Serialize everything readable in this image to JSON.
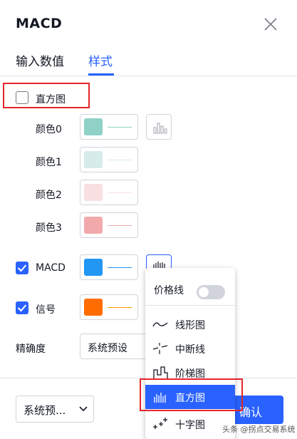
{
  "dialog": {
    "title": "MACD",
    "tabs": [
      {
        "label": "输入数值",
        "active": false
      },
      {
        "label": "样式",
        "active": true
      }
    ]
  },
  "style": {
    "histogram": {
      "label": "直方图",
      "checked": false
    },
    "colors": [
      {
        "label": "颜色0",
        "color": "#8fd1c6"
      },
      {
        "label": "颜色1",
        "color": "#d5ecea"
      },
      {
        "label": "颜色2",
        "color": "#f8dfe2"
      },
      {
        "label": "颜色3",
        "color": "#f2a9ab"
      }
    ],
    "macd": {
      "label": "MACD",
      "checked": true,
      "color": "#2196f3"
    },
    "signal": {
      "label": "信号",
      "checked": true,
      "color": "#ff6d00"
    },
    "precision": {
      "label": "精确度",
      "value": "系统预设"
    }
  },
  "footer": {
    "defaults_select": "系统预...",
    "confirm_label": "确认"
  },
  "dropdown": {
    "price_line_label": "价格线",
    "price_line_on": false,
    "items": [
      {
        "label": "线形图",
        "icon": "line-chart-icon",
        "selected": false
      },
      {
        "label": "中断线",
        "icon": "broken-line-icon",
        "selected": false
      },
      {
        "label": "阶梯图",
        "icon": "step-chart-icon",
        "selected": false
      },
      {
        "label": "直方图",
        "icon": "histogram-icon",
        "selected": true
      },
      {
        "label": "十字图",
        "icon": "cross-chart-icon",
        "selected": false
      }
    ]
  },
  "watermark": "头条 @拐点交易系统",
  "accent_color": "#2962ff"
}
